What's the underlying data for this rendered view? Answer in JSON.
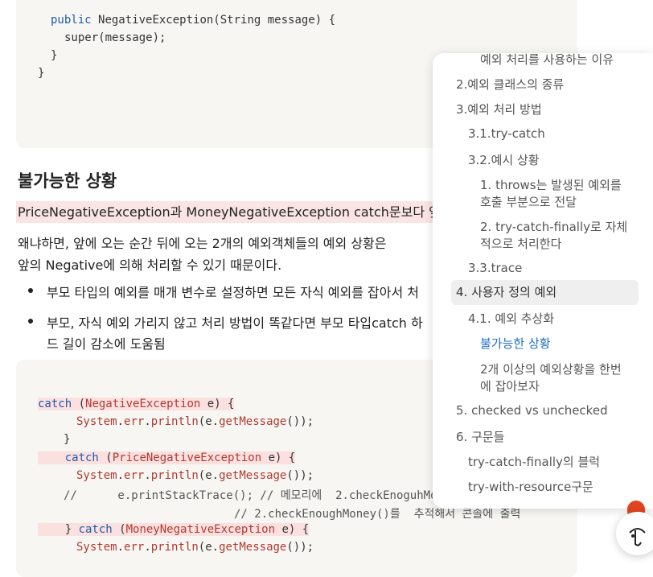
{
  "code_top": {
    "line1_kw": "public",
    "line1_rest": "NegativeException(String message) {",
    "line2": "super(message);",
    "line3": "}",
    "line4": "}"
  },
  "section_heading": "불가능한 상황",
  "highlight_text": "PriceNegativeException과 MoneyNegativeException catch문보다 앞",
  "para1_line1": "왜냐하면, 앞에 오는 순간 뒤에 오는 2개의 예외객체들의 예외 상황은",
  "para1_line2": "앞의 Negative에 의해 처리할 수 있기 때문이다.",
  "bullets": [
    "부모 타입의 예외를 매개 변수로 설정하면 모든 자식 예외를 잡아서 처",
    "부모, 자식 예외 가리지 않고 처리 방법이 똑같다면 부모 타입catch 하",
    "드 길이 감소에 도움됨"
  ],
  "code_bottom": {
    "catch_kw": "catch",
    "t1": "NegativeException",
    "v": "e",
    "sys": "System",
    "err": "err",
    "println": "println",
    "getMessage": "getMessage",
    "t2": "PriceNegativeException",
    "t3": "MoneyNegativeException",
    "comment1": "//      e.printStackTrace(); // 메모리에  2.checkEnoguhMon",
    "comment2": "// 2.checkEnoughMoney()를  추적해서 콘솔에 출력",
    "close": "}"
  },
  "toc": {
    "items": [
      {
        "label": "예외 처리를 사용하는 이유",
        "level": 3
      },
      {
        "label": "2.예외 클래스의 종류",
        "level": 1
      },
      {
        "label": "3.예외 처리 방법",
        "level": 1
      },
      {
        "label": "3.1.try-catch",
        "level": 2
      },
      {
        "label": "3.2.예시 상황",
        "level": 2
      },
      {
        "label": "1. throws는 발생된 예외를",
        "level": 3
      },
      {
        "label": "호출 부분으로 전달",
        "level": 3
      },
      {
        "label": "2. try-catch-finally로 자체",
        "level": 3
      },
      {
        "label": "적으로 처리한다",
        "level": 3
      },
      {
        "label": "3.3.trace",
        "level": 2
      },
      {
        "label": "4. 사용자 정의 예외",
        "level": 1,
        "current": true
      },
      {
        "label": "4.1. 예외 추상화",
        "level": 2
      },
      {
        "label": "불가능한 상황",
        "level": 3,
        "active": true
      },
      {
        "label": "2개 이상의 예외상황을 한번",
        "level": 3
      },
      {
        "label": "에 잡아보자",
        "level": 3
      },
      {
        "label": "5. checked vs unchecked",
        "level": 1
      },
      {
        "label": "6. 구문들",
        "level": 1
      },
      {
        "label": "try-catch-finally의 블럭",
        "level": 2
      },
      {
        "label": "try-with-resource구문",
        "level": 2
      }
    ]
  },
  "colors": {
    "accent": "#1e6fc8",
    "highlight": "#fbe4e4",
    "code_bg": "#f7f6f3"
  },
  "icons": {
    "fab": "mascot-face-icon"
  }
}
